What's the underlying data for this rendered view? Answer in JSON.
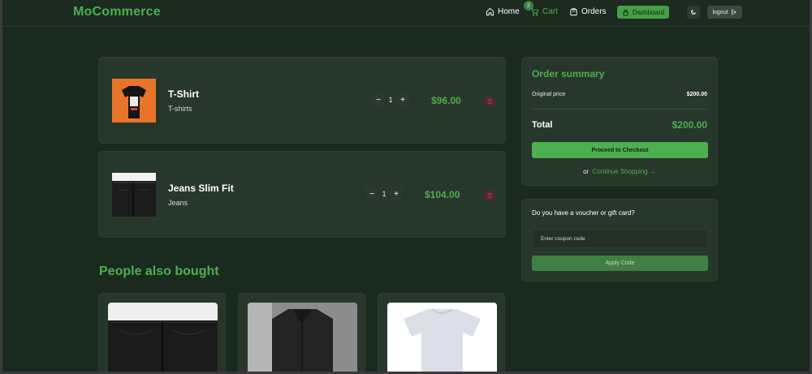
{
  "header": {
    "brand": "MoCommerce",
    "nav": {
      "home": "Home",
      "cart": "Cart",
      "cart_count": "2",
      "orders": "Orders",
      "dashboard": "Dashboard",
      "logout": "logout"
    },
    "icons": [
      "home-icon",
      "cart-icon",
      "orders-icon",
      "dashboard-icon",
      "moon-icon",
      "logout-icon"
    ]
  },
  "cart": {
    "items": [
      {
        "name": "T-Shirt",
        "category": "T-shirts",
        "quantity": "1",
        "price": "$96.00"
      },
      {
        "name": "Jeans Slim Fit",
        "category": "Jeans",
        "quantity": "1",
        "price": "$104.00"
      }
    ],
    "qty_minus": "−",
    "qty_plus": "+"
  },
  "recommendations": {
    "title": "People also bought"
  },
  "summary": {
    "title": "Order summary",
    "original_price_label": "Original price",
    "original_price_value": "$200.00",
    "total_label": "Total",
    "total_value": "$200.00",
    "checkout_label": "Proceed to Checkout",
    "or_text": "or",
    "continue_label": "Continue Shopping →"
  },
  "voucher": {
    "title": "Do you have a voucher or gift card?",
    "placeholder": "Enter coupon code",
    "apply_label": "Apply Code"
  },
  "colors": {
    "accent": "#4caf50",
    "background": "#1b2a1f",
    "card": "#28372c"
  }
}
